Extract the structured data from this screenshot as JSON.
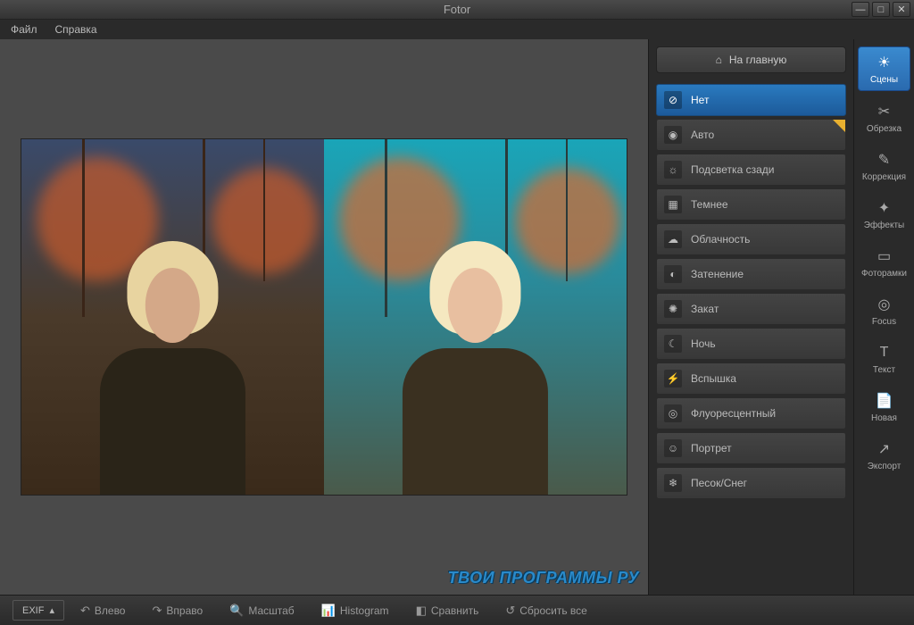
{
  "title": "Fotor",
  "menu": {
    "file": "Файл",
    "help": "Справка"
  },
  "home_button": "На главную",
  "presets": [
    {
      "label": "Нет",
      "icon": "⊘",
      "active": true
    },
    {
      "label": "Авто",
      "icon": "◉",
      "starred": true
    },
    {
      "label": "Подсветка сзади",
      "icon": "☼"
    },
    {
      "label": "Темнее",
      "icon": "▦"
    },
    {
      "label": "Облачность",
      "icon": "☁"
    },
    {
      "label": "Затенение",
      "icon": "◐"
    },
    {
      "label": "Закат",
      "icon": "✺"
    },
    {
      "label": "Ночь",
      "icon": "☾"
    },
    {
      "label": "Вспышка",
      "icon": "⚡"
    },
    {
      "label": "Флуоресцентный",
      "icon": "◎"
    },
    {
      "label": "Портрет",
      "icon": "☺"
    },
    {
      "label": "Песок/Снег",
      "icon": "❄"
    }
  ],
  "tools": [
    {
      "label": "Сцены",
      "icon": "☀",
      "active": true
    },
    {
      "label": "Обрезка",
      "icon": "✂"
    },
    {
      "label": "Коррекция",
      "icon": "✎"
    },
    {
      "label": "Эффекты",
      "icon": "✦"
    },
    {
      "label": "Фоторамки",
      "icon": "▭"
    },
    {
      "label": "Focus",
      "icon": "◎"
    },
    {
      "label": "Текст",
      "icon": "T"
    },
    {
      "label": "Новая",
      "icon": "📄"
    },
    {
      "label": "Экспорт",
      "icon": "↗"
    }
  ],
  "bottombar": {
    "exif": "EXIF",
    "buttons": [
      {
        "label": "Влево",
        "icon": "↶"
      },
      {
        "label": "Вправо",
        "icon": "↷"
      },
      {
        "label": "Масштаб",
        "icon": "🔍"
      },
      {
        "label": "Histogram",
        "icon": "📊"
      },
      {
        "label": "Сравнить",
        "icon": "◧"
      },
      {
        "label": "Сбросить все",
        "icon": "↺"
      }
    ]
  },
  "watermark": "ТВОИ ПРОГРАММЫ РУ"
}
